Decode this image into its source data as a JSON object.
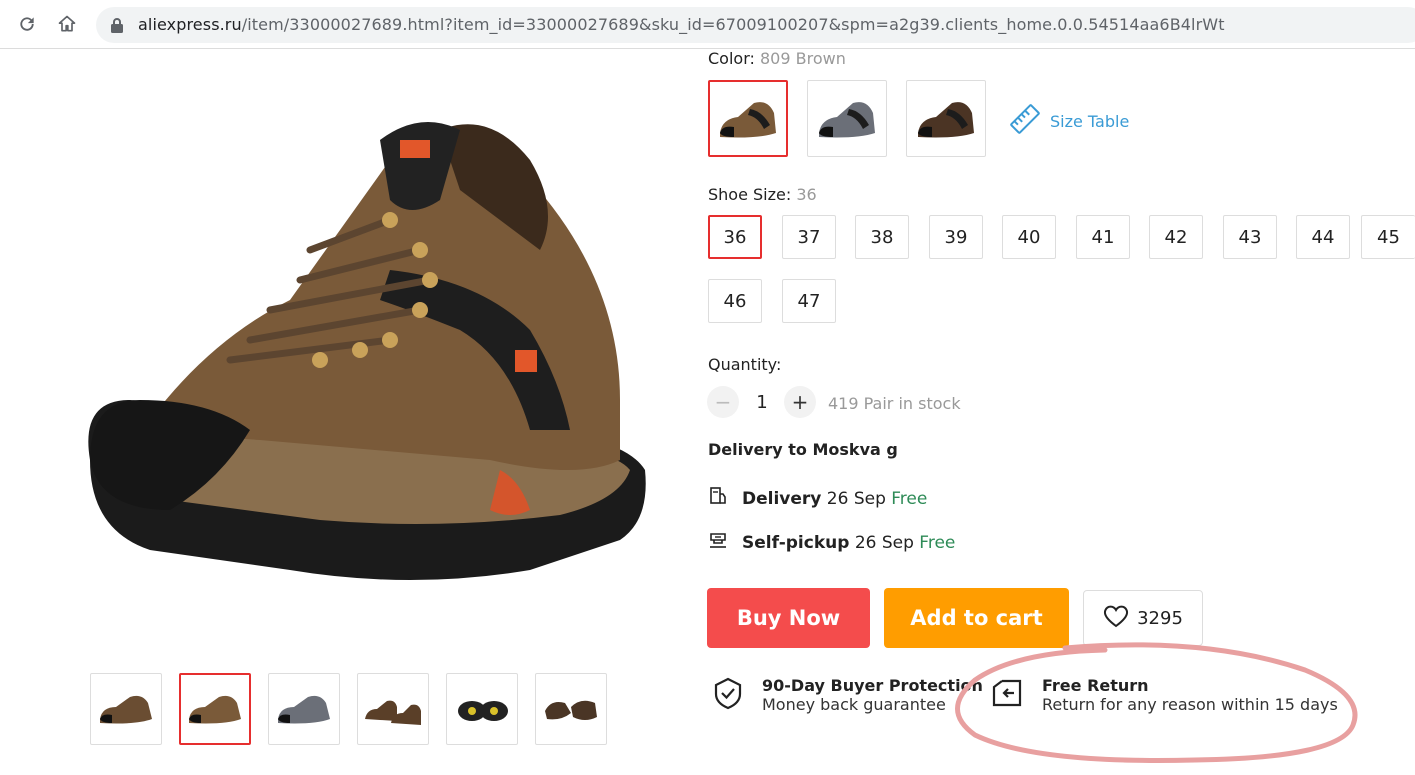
{
  "browser": {
    "url_host": "aliexpress.ru",
    "url_path": "/item/33000027689.html?item_id=33000027689&sku_id=67009100207&spm=a2g39.clients_home.0.0.54514aa6B4lrWt",
    "reload_icon": "reload-icon",
    "home_icon": "home-icon",
    "lock_icon": "lock-icon"
  },
  "product": {
    "color_label": "Color:",
    "color_value": "809 Brown",
    "size_table_label": "Size Table",
    "size_label": "Shoe Size:",
    "size_value": "36",
    "sizes": [
      "36",
      "37",
      "38",
      "39",
      "40",
      "41",
      "42",
      "43",
      "44",
      "45",
      "46",
      "47"
    ],
    "selected_size": "36",
    "quantity_label": "Quantity:",
    "quantity_minus": "−",
    "quantity_plus": "+",
    "quantity": "1",
    "stock_text": "419 Pair in stock"
  },
  "delivery": {
    "title": "Delivery to Moskva g",
    "rows": [
      {
        "label": "Delivery",
        "date": "26 Sep",
        "price": "Free"
      },
      {
        "label": "Self-pickup",
        "date": "26 Sep",
        "price": "Free"
      }
    ]
  },
  "actions": {
    "buy_now": "Buy Now",
    "add_to_cart": "Add to cart",
    "wishlist_count": "3295"
  },
  "features": {
    "protection_title": "90-Day Buyer Protection",
    "protection_sub": "Money back guarantee",
    "return_title": "Free Return",
    "return_sub": "Return for any reason within 15 days"
  },
  "colors": {
    "accent_red": "#e62e2e",
    "buy_red": "#f44c4c",
    "cart_orange": "#ff9d00",
    "free_green": "#2e8b57",
    "link_blue": "#3a9bd5",
    "annotation_pink": "#e8a0a0"
  }
}
